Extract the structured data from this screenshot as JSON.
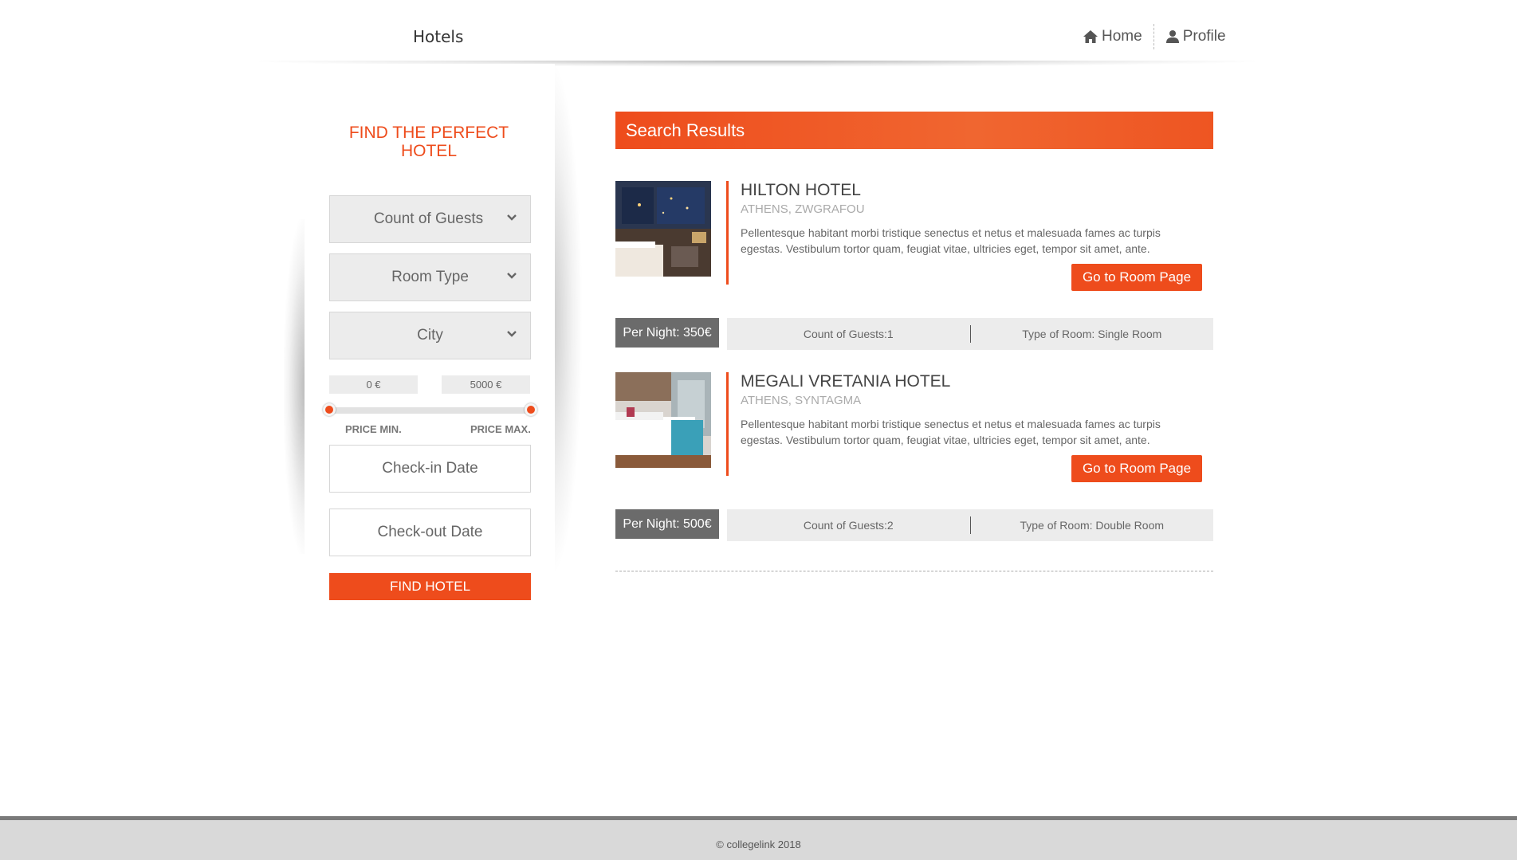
{
  "header": {
    "brand": "Hotels",
    "nav": [
      {
        "label": "Home",
        "icon": "home-icon"
      },
      {
        "label": "Profile",
        "icon": "user-icon"
      }
    ]
  },
  "sidebar": {
    "title": "FIND THE PERFECT HOTEL",
    "selects": {
      "guests": "Count of Guests",
      "room_type": "Room Type",
      "city": "City"
    },
    "price": {
      "min_value": "0 €",
      "max_value": "5000 €",
      "min_label": "PRICE MIN.",
      "max_label": "PRICE MAX.",
      "slider_min_fraction": 0,
      "slider_max_fraction": 1
    },
    "checkin_placeholder": "Check-in Date",
    "checkout_placeholder": "Check-out Date",
    "find_button": "FIND HOTEL"
  },
  "results": {
    "title": "Search Results",
    "hotels": [
      {
        "name": "HILTON HOTEL",
        "location": "ATHENS, ZWGRAFOU",
        "description": "Pellentesque habitant morbi tristique senectus et netus et malesuada fames ac turpis egestas. Vestibulum tortor quam, feugiat vitae, ultricies eget, tempor sit amet, ante.",
        "button": "Go to Room Page",
        "per_night": "Per Night: 350€",
        "guests": "Count of Guests:1",
        "room_type": "Type of Room: Single Room"
      },
      {
        "name": "MEGALI VRETANIA HOTEL",
        "location": "ATHENS, SYNTAGMA",
        "description": "Pellentesque habitant morbi tristique senectus et netus et malesuada fames ac turpis egestas. Vestibulum tortor quam, feugiat vitae, ultricies eget, tempor sit amet, ante.",
        "button": "Go to Room Page",
        "per_night": "Per Night: 500€",
        "guests": "Count of Guests:2",
        "room_type": "Type of Room: Double Room"
      }
    ]
  },
  "footer": {
    "copyright": "© collegelink 2018"
  },
  "colors": {
    "accent": "#ee4c1c",
    "per_night_bg": "#6b6b6b",
    "footer_bg": "#d9d9d9"
  }
}
